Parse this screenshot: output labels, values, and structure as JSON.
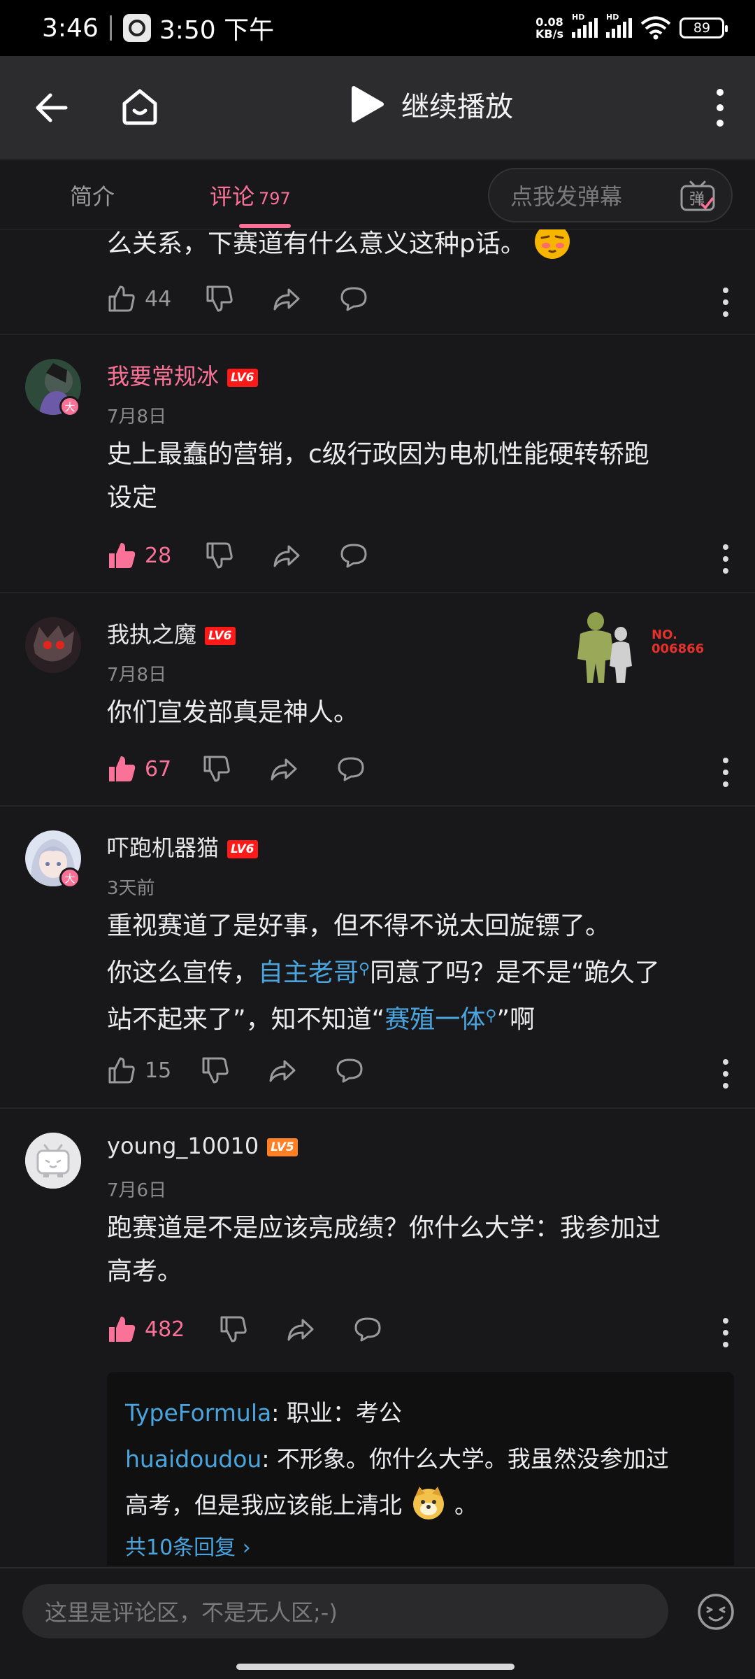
{
  "status_bar": {
    "time": "3:46",
    "clock_time": "3:50 下午",
    "net_speed": "0.08",
    "net_unit": "KB/s",
    "battery": "89"
  },
  "header": {
    "play_label": "继续播放"
  },
  "tabs": {
    "intro": "简介",
    "comments": "评论",
    "comments_count": "797",
    "danmaku_placeholder": "点我发弹幕",
    "danmaku_icon_text": "弹"
  },
  "comments": [
    {
      "body": "么关系，下赛道有什么意义这种p话。",
      "likes": "44",
      "liked": false
    },
    {
      "user": "我要常规冰",
      "level": "LV6",
      "badge": "大",
      "date": "7月8日",
      "body_lines": [
        "史上最蠢的营销，c级行政因为电机性能硬转轿跑",
        "设定"
      ],
      "likes": "28",
      "liked": true
    },
    {
      "user": "我执之魔",
      "level": "LV6",
      "date": "7月8日",
      "decoration": [
        "NO.",
        "006866"
      ],
      "body": "你们宣发部真是神人。",
      "likes": "67",
      "liked": true
    },
    {
      "user": "吓跑机器猫",
      "level": "LV6",
      "badge": "大",
      "date": "3天前",
      "body_line1": "重视赛道了是好事，但不得不说太回旋镖了。",
      "body_line2_a": "你这么宣传，",
      "body_line2_link": "自主老哥",
      "body_line2_b": "同意了吗？是不是“跪久了",
      "body_line3_a": "站不起来了”，知不知道“",
      "body_line3_link": "赛殖一体",
      "body_line3_b": "”啊",
      "likes": "15",
      "liked": false
    },
    {
      "user": "young_10010",
      "level": "LV5",
      "date": "7月6日",
      "body_lines": [
        "跑赛道是不是应该亮成绩？你什么大学：我参加过",
        "高考。"
      ],
      "likes": "482",
      "liked": true,
      "replies": [
        {
          "user": "TypeFormula",
          "text": ": 职业：考公"
        },
        {
          "user": "huaidoudou",
          "text": ": 不形象。你什么大学。我虽然没参加过",
          "text2": "高考，但是我应该能上清北",
          "text3": " 。"
        }
      ],
      "replies_total": "共10条回复 ›"
    }
  ],
  "input": {
    "placeholder": "这里是评论区，不是无人区;-)"
  },
  "colors": {
    "accent": "#fb7299",
    "link": "#4aa4de",
    "background": "#18181a",
    "header": "#2c2c2e"
  }
}
